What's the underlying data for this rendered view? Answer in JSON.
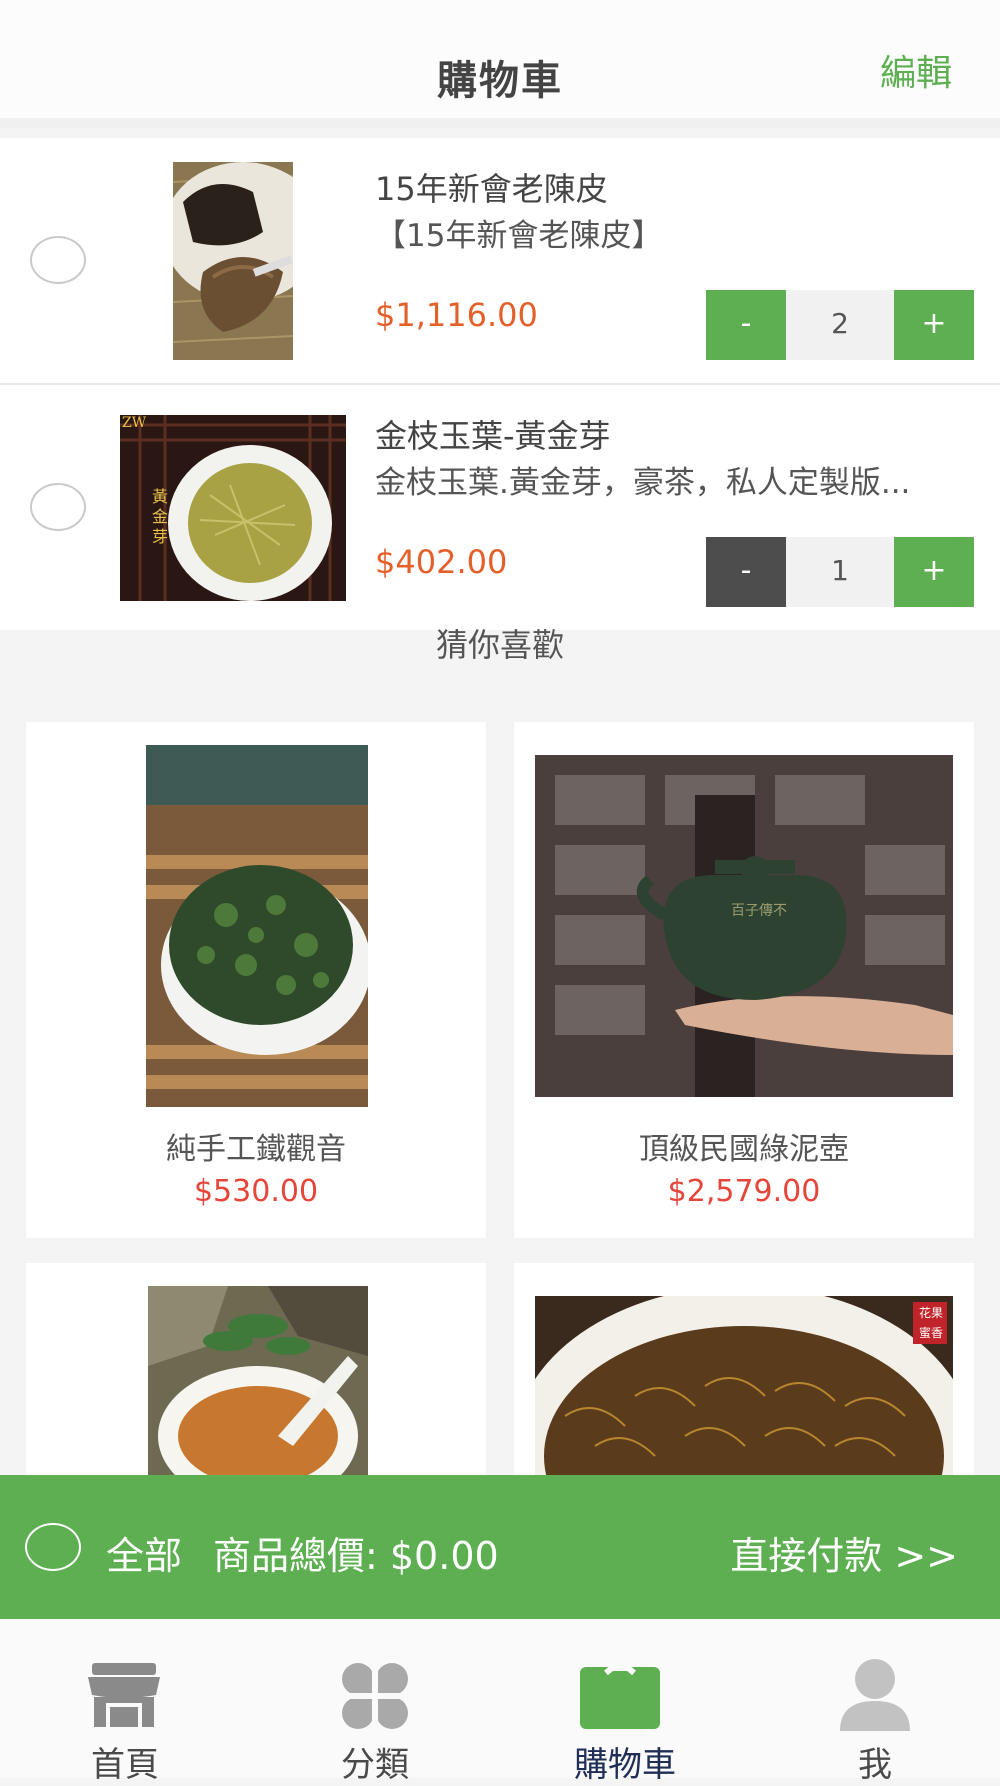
{
  "header": {
    "title": "購物車",
    "edit_label": "編輯"
  },
  "cart": {
    "items": [
      {
        "name": "15年新會老陳皮",
        "desc": "【15年新會老陳皮】",
        "price": "$1,116.00",
        "qty": "2",
        "minus": "-",
        "plus": "+"
      },
      {
        "name": "金枝玉葉-黃金芽",
        "desc": "金枝玉葉.黃金芽，豪茶，私人定製版...",
        "price": "$402.00",
        "qty": "1",
        "minus": "-",
        "plus": "+"
      }
    ],
    "img2_logo": "ZW",
    "img2_label": "黃金芽"
  },
  "recommend": {
    "title": "猜你喜歡",
    "products": [
      {
        "name": "純手工鐵觀音",
        "price": "$530.00"
      },
      {
        "name": "頂級民國綠泥壺",
        "price": "$2,579.00"
      },
      {
        "name": "",
        "price": ""
      },
      {
        "name": "",
        "price": ""
      }
    ],
    "teapot_inscription": "百子傳不",
    "tea4_badge": "花果蜜香"
  },
  "checkout": {
    "all_label": "全部",
    "total_label": "商品總價: $0.00",
    "pay_label": "直接付款 >>"
  },
  "tabbar": {
    "tabs": [
      {
        "label": "首頁",
        "icon": "store-icon"
      },
      {
        "label": "分類",
        "icon": "category-icon"
      },
      {
        "label": "購物車",
        "icon": "cart-icon"
      },
      {
        "label": "我",
        "icon": "user-icon"
      }
    ],
    "active_index": 2
  },
  "colors": {
    "accent": "#5daf51",
    "price_orange": "#e4602b",
    "price_red": "#e4463a",
    "tab_active": "#1f2e55"
  }
}
